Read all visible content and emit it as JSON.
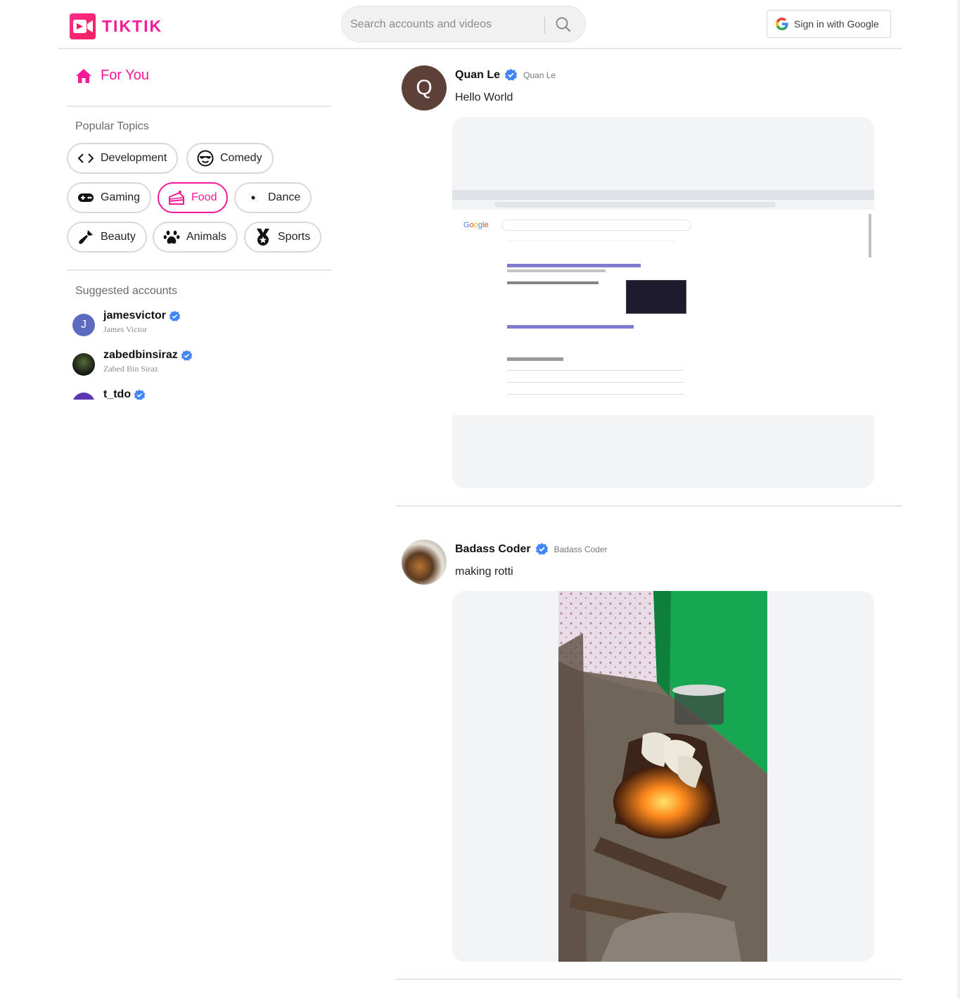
{
  "header": {
    "logo_text": "TIKTIK",
    "search_placeholder": "Search accounts and videos",
    "signin_label": "Sign in with Google"
  },
  "sidebar": {
    "for_you": "For You",
    "popular_topics_title": "Popular Topics",
    "topics": [
      {
        "label": "Development",
        "icon": "code-icon",
        "active": false
      },
      {
        "label": "Comedy",
        "icon": "sunglasses-smiley-icon",
        "active": false
      },
      {
        "label": "Gaming",
        "icon": "gamepad-icon",
        "active": false
      },
      {
        "label": "Food",
        "icon": "cake-icon",
        "active": true
      },
      {
        "label": "Dance",
        "icon": "disco-icon",
        "active": false
      },
      {
        "label": "Beauty",
        "icon": "lipstick-icon",
        "active": false
      },
      {
        "label": "Animals",
        "icon": "paw-icon",
        "active": false
      },
      {
        "label": "Sports",
        "icon": "medal-icon",
        "active": false
      }
    ],
    "suggested_title": "Suggested accounts",
    "accounts": [
      {
        "username": "jamesvictor",
        "name": "James Victor",
        "initial": "J"
      },
      {
        "username": "zabedbinsiraz",
        "name": "Zabed Bin Siraz"
      },
      {
        "username": "t_tdo",
        "name": ""
      }
    ]
  },
  "feed": [
    {
      "initial": "Q",
      "username": "Quan Le",
      "name": "Quan Le",
      "caption": "Hello World"
    },
    {
      "username": "Badass Coder",
      "name": "Badass Coder",
      "caption": "making rotti"
    }
  ],
  "colors": {
    "brand": "#f51997",
    "verified": "#4285f4"
  }
}
